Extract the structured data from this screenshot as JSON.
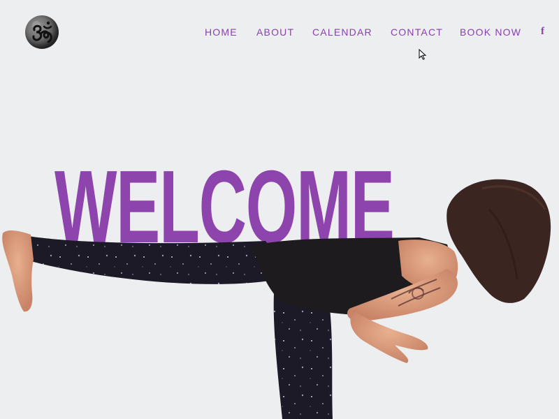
{
  "logo": {
    "icon": "om-icon"
  },
  "nav": {
    "items": [
      {
        "label": "HOME"
      },
      {
        "label": "ABOUT"
      },
      {
        "label": "CALENDAR"
      },
      {
        "label": "CONTACT"
      },
      {
        "label": "BOOK NOW"
      }
    ],
    "facebook": {
      "label": "f",
      "icon": "facebook-icon"
    }
  },
  "hero": {
    "title": "WELCOME"
  },
  "colors": {
    "accent": "#8e44ad",
    "nav_text": "#8a3fb0",
    "background": "#eceef0"
  }
}
